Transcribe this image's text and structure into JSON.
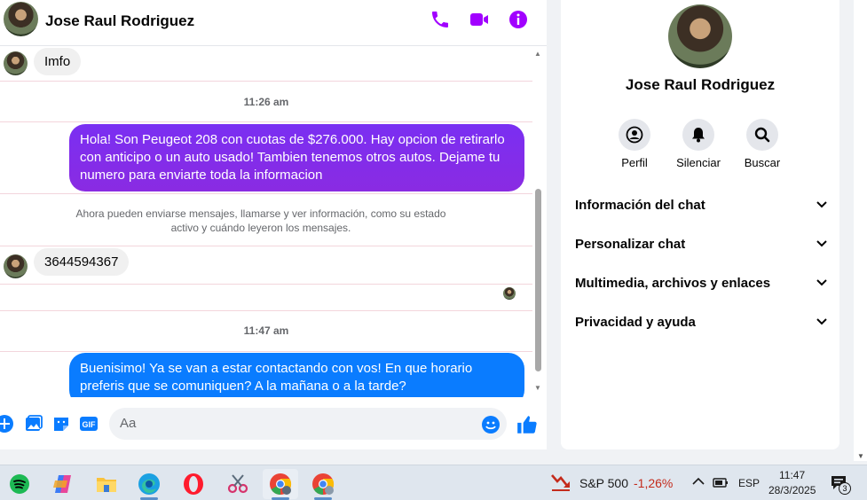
{
  "contact": {
    "name": "Jose Raul Rodriguez"
  },
  "header": {
    "icons": [
      "phone-icon",
      "video-icon",
      "info-icon"
    ]
  },
  "messages": {
    "incoming_1": "Imfo",
    "time_1": "11:26 am",
    "outgoing_1": "Hola! Son Peugeot 208 con cuotas de $276.000. Hay opcion de retirarlo con anticipo o un auto usado! Tambien tenemos otros autos. Dejame tu numero para enviarte toda la informacion",
    "notice_line_1": "Ahora pueden enviarse mensajes, llamarse y ver información, como su estado",
    "notice_line_2": "activo y cuándo leyeron los mensajes.",
    "incoming_2": "3644594367",
    "time_2": "11:47 am",
    "outgoing_2": "Buenisimo! Ya se van a estar contactando con vos! En que horario preferis que se comuniquen? A la mañana o a la tarde?"
  },
  "composer": {
    "placeholder": "Aa"
  },
  "info_panel": {
    "actions": [
      {
        "label": "Perfil"
      },
      {
        "label": "Silenciar"
      },
      {
        "label": "Buscar"
      }
    ],
    "sections": [
      {
        "label": "Información del chat"
      },
      {
        "label": "Personalizar chat"
      },
      {
        "label": "Multimedia, archivos y enlaces"
      },
      {
        "label": "Privacidad y ayuda"
      }
    ]
  },
  "taskbar": {
    "stock_label": "S&P 500",
    "stock_change": "-1,26%",
    "language": "ESP",
    "time": "11:47",
    "date": "28/3/2025",
    "notifications": "3"
  },
  "colors": {
    "accent": "#a100ff",
    "outgoing_purple": "#7a2ff2",
    "outgoing_blue": "#0a7cff",
    "stock_down": "#c42b1c"
  }
}
